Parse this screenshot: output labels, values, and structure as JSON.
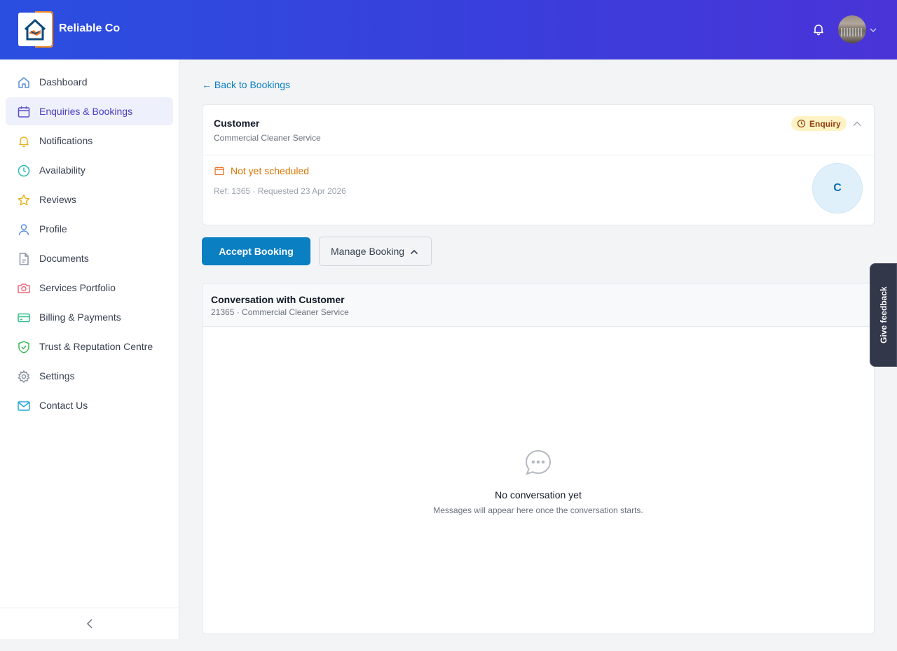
{
  "header": {
    "brand": "Reliable Co",
    "icons": {
      "notifications": "bell-icon",
      "avatar_caret": "chevron-down-icon"
    }
  },
  "sidebar": {
    "items": [
      {
        "label": "Dashboard",
        "icon": "home-icon",
        "active": false
      },
      {
        "label": "Enquiries & Bookings",
        "icon": "calendar-icon",
        "active": true
      },
      {
        "label": "Notifications",
        "icon": "bell-icon",
        "active": false
      },
      {
        "label": "Availability",
        "icon": "clock-icon",
        "active": false
      },
      {
        "label": "Reviews",
        "icon": "star-icon",
        "active": false
      },
      {
        "label": "Profile",
        "icon": "user-icon",
        "active": false
      },
      {
        "label": "Documents",
        "icon": "document-icon",
        "active": false
      },
      {
        "label": "Services Portfolio",
        "icon": "camera-icon",
        "active": false
      },
      {
        "label": "Billing & Payments",
        "icon": "credit-card-icon",
        "active": false
      },
      {
        "label": "Trust & Reputation Centre",
        "icon": "shield-check-icon",
        "active": false
      },
      {
        "label": "Settings",
        "icon": "gear-icon",
        "active": false
      },
      {
        "label": "Contact Us",
        "icon": "mail-icon",
        "active": false
      }
    ],
    "collapse_icon": "chevron-left-icon"
  },
  "main": {
    "back_link": "← Back to Bookings",
    "booking": {
      "title": "Customer",
      "service": "Commercial Cleaner Service",
      "status": "Enquiry",
      "schedule": "Not yet scheduled",
      "ref": "Ref: 1365 · Requested 23 Apr 2026",
      "initial": "C"
    },
    "actions": {
      "accept": "Accept Booking",
      "manage": "Manage Booking"
    },
    "conversation": {
      "title": "Conversation with Customer",
      "subtitle": "21365 · Commercial Cleaner Service",
      "empty_title": "No conversation yet",
      "empty_sub": "Messages will appear here once the conversation starts."
    }
  },
  "feedback": {
    "label": "Give feedback"
  },
  "colors": {
    "header_gradient_start": "#2a4fe0",
    "header_gradient_end": "#4a34d8",
    "primary": "#0a7fc2",
    "active_nav_bg": "#eef0fb",
    "enquiry_badge_bg": "#fdf3c4",
    "schedule_warning": "#d97706"
  }
}
